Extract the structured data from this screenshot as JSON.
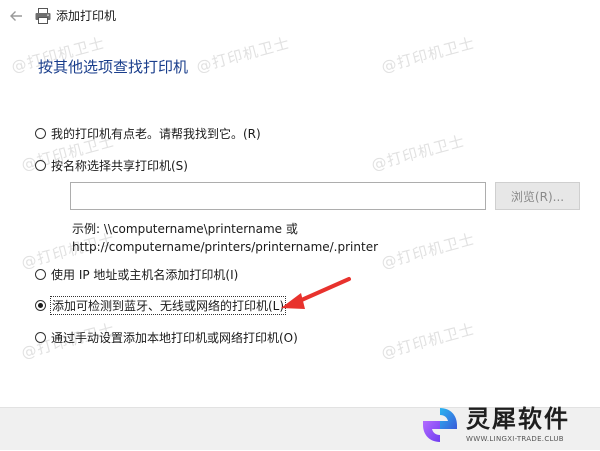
{
  "window": {
    "title": "添加打印机"
  },
  "heading": "按其他选项查找打印机",
  "options": [
    {
      "label": "我的打印机有点老。请帮我找到它。(R)",
      "checked": false
    },
    {
      "label": "按名称选择共享打印机(S)",
      "checked": false
    },
    {
      "label": "使用 IP 地址或主机名添加打印机(I)",
      "checked": false
    },
    {
      "label": "添加可检测到蓝牙、无线或网络的打印机(L)",
      "checked": true
    },
    {
      "label": "通过手动设置添加本地打印机或网络打印机(O)",
      "checked": false
    }
  ],
  "share_input": {
    "value": ""
  },
  "browse_button": "浏览(R)...",
  "example": {
    "line1": "示例: \\\\computername\\printername 或",
    "line2": "http://computername/printers/printername/.printer"
  },
  "watermark": "@打印机卫士",
  "brand": {
    "name": "灵犀软件",
    "url": "WWW.LINGXI-TRADE.CLUB"
  },
  "colors": {
    "heading": "#1a3e8c",
    "arrow": "#e8322d",
    "footer": "#f0f0f0"
  }
}
